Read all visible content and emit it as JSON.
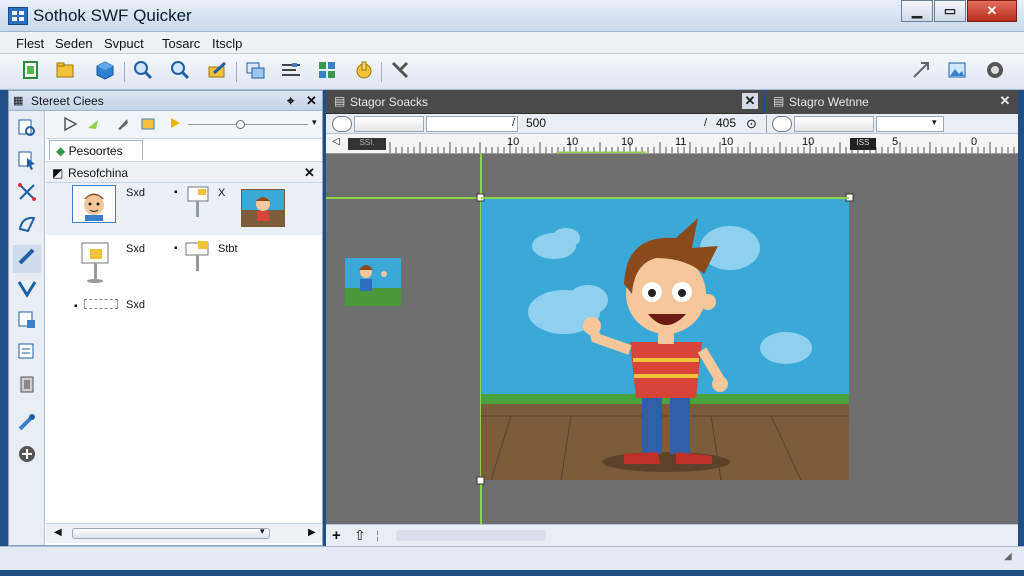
{
  "window": {
    "title": "Sothok SWF Quicker",
    "min": "▁",
    "max": "▭",
    "close": "✕"
  },
  "menu": [
    "Flest",
    "Seden",
    "Svpuct",
    "Tosarc",
    "Itsclp"
  ],
  "toolbar": [
    "new-doc-icon",
    "open-folder-icon",
    "cube-icon",
    "zoom-icon",
    "search-icon",
    "pencil-folder-icon",
    "layers-icon",
    "align-icon",
    "grid-icon",
    "hand-icon",
    "tools-icon",
    "expand-icon",
    "image-icon",
    "globe-icon"
  ],
  "left_panel": {
    "title": "Stereet Ciees",
    "pin": "⌖",
    "close": "✕",
    "tab": "Pesoortes",
    "res_title": "Resofchina",
    "res_close": "✕",
    "items": [
      {
        "label": "Sxd",
        "icon": "boy-face-icon"
      },
      {
        "label": "X",
        "icon": "sign-icon"
      },
      {
        "label": "Sxd",
        "icon": "stand-icon"
      },
      {
        "label": "Stbt",
        "icon": "flag-icon"
      },
      {
        "label": "Sxd",
        "icon": "dotted-box-icon"
      }
    ],
    "scroll_left": "◀",
    "scroll_right": "▶"
  },
  "stage": {
    "title": "Stagor Soacks",
    "close": "✕",
    "value_1": "500",
    "value_2": "405",
    "ruler": [
      "10",
      "10",
      "10",
      "11",
      "10",
      "10",
      "5",
      "0"
    ],
    "ruler_tag_1": "SSI.",
    "ruler_tag_2": "ISS"
  },
  "web_panel": {
    "title": "Stagro Wetnne",
    "close": "✕"
  },
  "bottom": {
    "add": "+",
    "up": "⇧",
    "sep": "¦"
  },
  "colors": {
    "accent": "#8ed34a",
    "panel_dark": "#4a4a4a",
    "canvas": "#6f6f6f",
    "sky": "#3aa9d8"
  }
}
